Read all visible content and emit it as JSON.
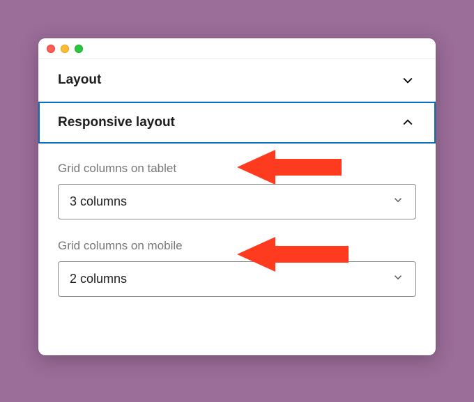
{
  "sections": {
    "layout": {
      "title": "Layout",
      "expanded": false
    },
    "responsive": {
      "title": "Responsive layout",
      "expanded": true
    }
  },
  "fields": {
    "tablet": {
      "label": "Grid columns on tablet",
      "value": "3 columns"
    },
    "mobile": {
      "label": "Grid columns on mobile",
      "value": "2 columns"
    }
  },
  "annotation": {
    "arrow_color": "#ff3b1f"
  }
}
